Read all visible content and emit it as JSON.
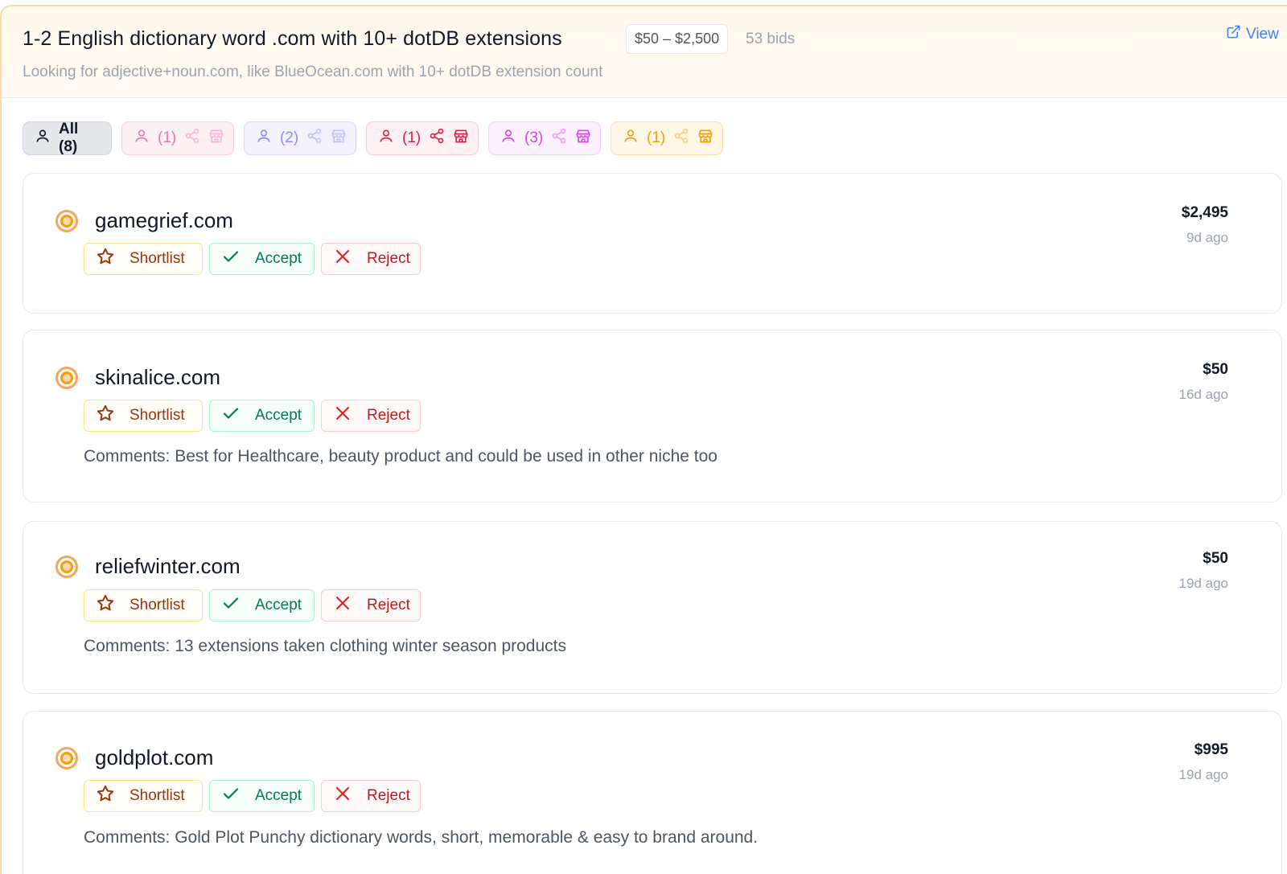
{
  "request": {
    "title": "1-2 English dictionary word .com with 10+ dotDB extensions",
    "budget": "$50 – $2,500",
    "bids": "53 bids",
    "description": "Looking for adjective+noun.com, like BlueOcean.com with 10+ dotDB extension count",
    "view_label": "View"
  },
  "filters": [
    {
      "label": "All (8)",
      "icon": "user-icon",
      "color": "#111827"
    },
    {
      "label": "(1)",
      "icon": "user-icon",
      "extra_icons": [
        "share-icon",
        "store-icon"
      ],
      "active_extras": false,
      "color": "#f472b6"
    },
    {
      "label": "(2)",
      "icon": "user-icon",
      "extra_icons": [
        "share-icon",
        "store-icon"
      ],
      "active_extras": false,
      "color": "#8b8cf0"
    },
    {
      "label": "(1)",
      "icon": "user-icon",
      "extra_icons": [
        "share-icon",
        "store-icon"
      ],
      "active_extras": true,
      "color": "#e11d48"
    },
    {
      "label": "(3)",
      "icon": "user-icon",
      "extra_icons": [
        "share-icon",
        "store-icon"
      ],
      "active_extras": "store-only",
      "color": "#d946ef"
    },
    {
      "label": "(1)",
      "icon": "user-icon",
      "extra_icons": [
        "share-icon",
        "store-icon"
      ],
      "active_extras": "store-only",
      "color": "#f59e0b"
    }
  ],
  "actions": {
    "shortlist": "Shortlist",
    "accept": "Accept",
    "reject": "Reject",
    "comment_label": "Comments:"
  },
  "bids": [
    {
      "domain": "gamegrief.com",
      "price": "$2,495",
      "ago": "9d ago",
      "comment": ""
    },
    {
      "domain": "skinalice.com",
      "price": "$50",
      "ago": "16d ago",
      "comment": "Best for Healthcare, beauty product and could be used in other niche too"
    },
    {
      "domain": "reliefwinter.com",
      "price": "$50",
      "ago": "19d ago",
      "comment": "13 extensions taken clothing winter season products"
    },
    {
      "domain": "goldplot.com",
      "price": "$995",
      "ago": "19d ago",
      "comment": "Gold Plot Punchy dictionary words, short, memorable & easy to brand around."
    }
  ],
  "colors": {
    "header_bg": "#fff8ec",
    "accent_orange": "#f59e0b",
    "link_blue": "#3b82f6",
    "accept_green": "#047857",
    "reject_red": "#b91c1c"
  }
}
